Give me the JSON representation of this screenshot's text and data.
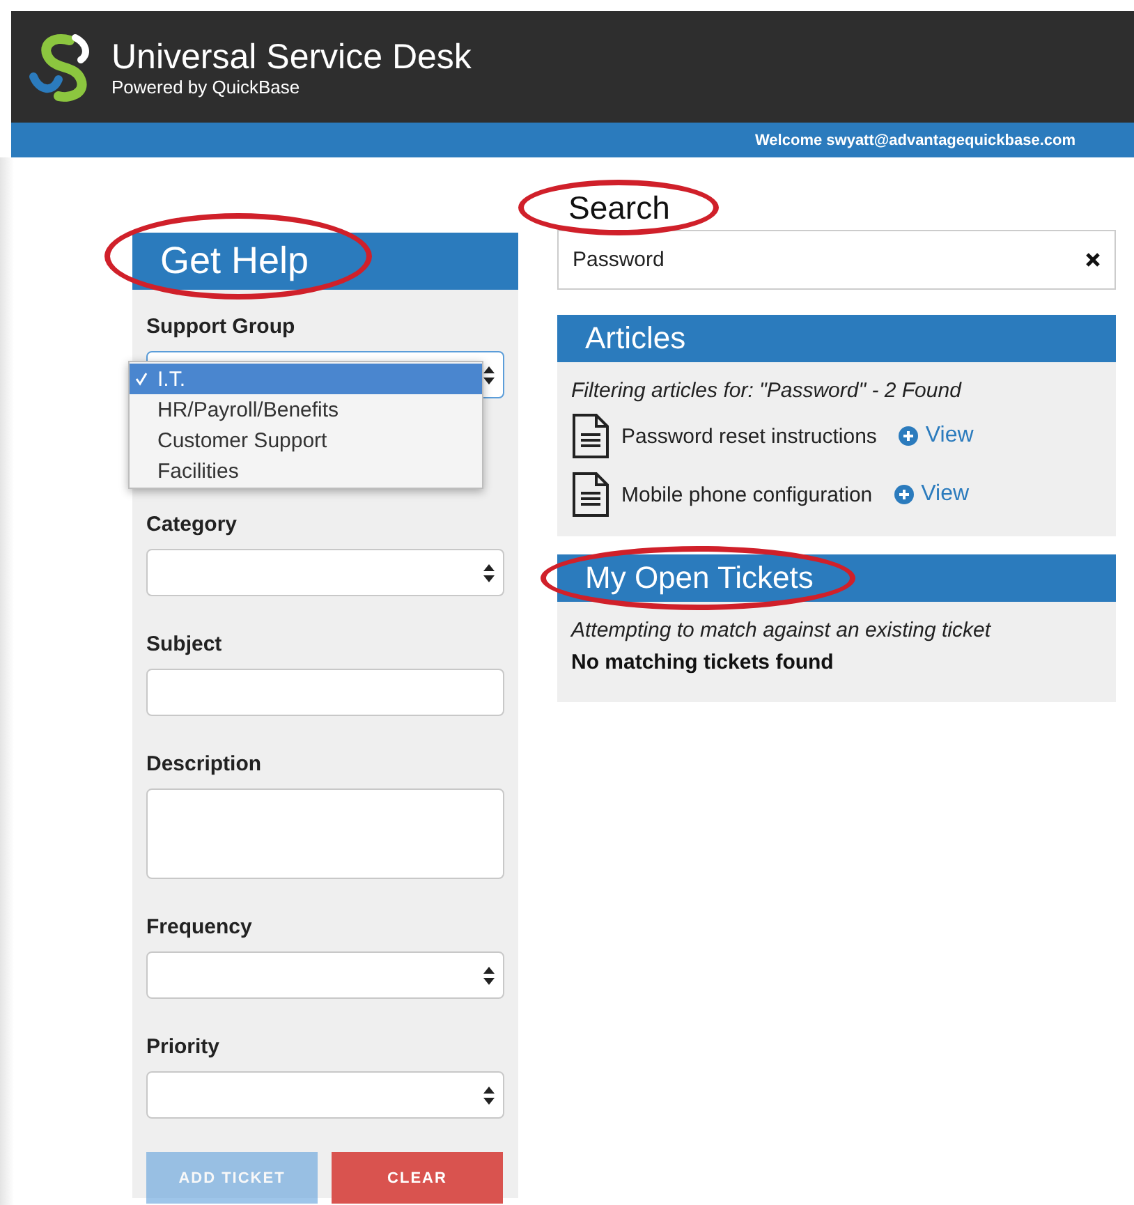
{
  "header": {
    "title": "Universal Service Desk",
    "subtitle": "Powered by QuickBase",
    "welcome": "Welcome swyatt@advantagequickbase.com"
  },
  "get_help": {
    "title": "Get Help",
    "circled": true,
    "fields": [
      {
        "kind": "select",
        "label": "Support Group",
        "open": true,
        "options": [
          {
            "label": "I.T.",
            "selected": true
          },
          {
            "label": "HR/Payroll/Benefits",
            "selected": false
          },
          {
            "label": "Customer Support",
            "selected": false
          },
          {
            "label": "Facilities",
            "selected": false
          }
        ]
      },
      {
        "kind": "select",
        "label": "Category",
        "open": false
      },
      {
        "kind": "text",
        "label": "Subject"
      },
      {
        "kind": "textarea",
        "label": "Description"
      },
      {
        "kind": "select",
        "label": "Frequency",
        "open": false
      },
      {
        "kind": "select",
        "label": "Priority",
        "open": false
      }
    ],
    "buttons": [
      {
        "label": "ADD TICKET",
        "kind": "primary",
        "disabled": true
      },
      {
        "label": "CLEAR",
        "kind": "danger",
        "disabled": false
      }
    ]
  },
  "search": {
    "title": "Search",
    "circled": true,
    "value": "Password"
  },
  "articles": {
    "title": "Articles",
    "circled": false,
    "filter_text": "Filtering articles for: \"Password\" - 2 Found",
    "items": [
      {
        "title": "Password reset instructions",
        "link": "View"
      },
      {
        "title": "Mobile phone configuration",
        "link": "View"
      }
    ]
  },
  "tickets": {
    "title": "My Open Tickets",
    "circled": true,
    "status": "Attempting to match against an existing ticket",
    "result": "No matching tickets found"
  }
}
